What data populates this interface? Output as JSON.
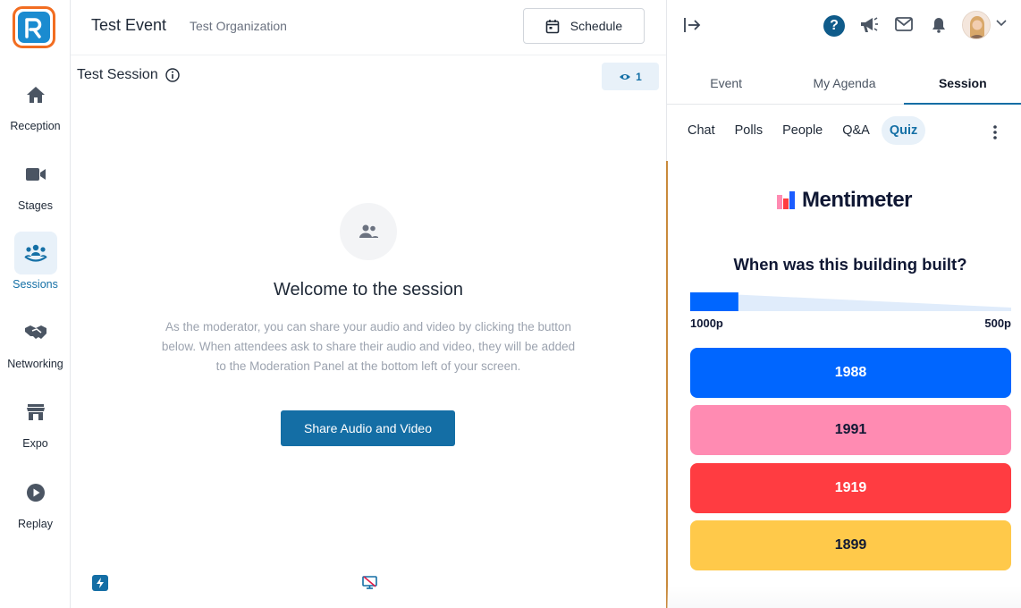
{
  "sidebar": {
    "items": [
      {
        "label": "Reception",
        "icon": "home-icon",
        "active": false
      },
      {
        "label": "Stages",
        "icon": "video-camera-icon",
        "active": false
      },
      {
        "label": "Sessions",
        "icon": "people-group-icon",
        "active": true
      },
      {
        "label": "Networking",
        "icon": "handshake-icon",
        "active": false
      },
      {
        "label": "Expo",
        "icon": "storefront-icon",
        "active": false
      },
      {
        "label": "Replay",
        "icon": "play-circle-icon",
        "active": false
      }
    ]
  },
  "header": {
    "event_title": "Test Event",
    "org_title": "Test Organization",
    "schedule_label": "Schedule"
  },
  "session": {
    "title": "Test Session",
    "viewer_count": "1",
    "welcome_title": "Welcome to the session",
    "welcome_desc": "As the moderator, you can share your audio and video by clicking the button below. When attendees ask to share their audio and video, they will be added to the Moderation Panel at the bottom left of your screen.",
    "share_button": "Share Audio and Video"
  },
  "right_panel": {
    "main_tabs": [
      {
        "label": "Event",
        "active": false
      },
      {
        "label": "My Agenda",
        "active": false
      },
      {
        "label": "Session",
        "active": true
      }
    ],
    "sub_tabs": [
      {
        "label": "Chat",
        "active": false
      },
      {
        "label": "Polls",
        "active": false
      },
      {
        "label": "People",
        "active": false
      },
      {
        "label": "Q&A",
        "active": false
      },
      {
        "label": "Quiz",
        "active": true
      }
    ],
    "help_label": "?"
  },
  "quiz": {
    "brand": "Mentimeter",
    "question": "When was this building built?",
    "timer_progress": 0.15,
    "max_points": "1000p",
    "min_points": "500p",
    "answers": [
      {
        "label": "1988",
        "color": "#0066ff",
        "text_color": "#ffffff"
      },
      {
        "label": "1991",
        "color": "#ff8bb2",
        "text_color": "#101834"
      },
      {
        "label": "1919",
        "color": "#ff3c41",
        "text_color": "#ffffff"
      },
      {
        "label": "1899",
        "color": "#ffc94a",
        "text_color": "#101834"
      }
    ]
  },
  "colors": {
    "primary": "#146ea5",
    "logo_border": "#f26d21",
    "logo_fill": "#1a8bd0",
    "active_bg": "#e8f1f9"
  }
}
